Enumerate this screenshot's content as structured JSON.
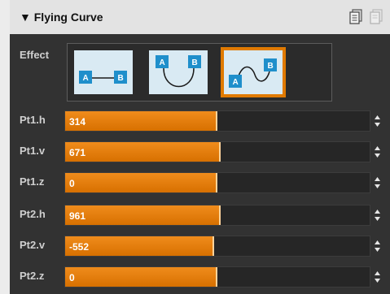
{
  "panel": {
    "title": "Flying Curve",
    "collapse_glyph": "▼",
    "header_icons": [
      "copy-icon",
      "paste-icon"
    ]
  },
  "effect": {
    "label": "Effect",
    "options": [
      {
        "name": "straight-line",
        "point_a": "A",
        "point_b": "B"
      },
      {
        "name": "u-curve",
        "point_a": "A",
        "point_b": "B"
      },
      {
        "name": "s-curve",
        "point_a": "A",
        "point_b": "B"
      }
    ],
    "selected_index": 2
  },
  "sliders": [
    {
      "label": "Pt1.h",
      "value": "314",
      "fill_fraction": 0.5
    },
    {
      "label": "Pt1.v",
      "value": "671",
      "fill_fraction": 0.51
    },
    {
      "label": "Pt1.z",
      "value": "0",
      "fill_fraction": 0.5
    },
    {
      "label": "Pt2.h",
      "value": "961",
      "fill_fraction": 0.51
    },
    {
      "label": "Pt2.v",
      "value": "-552",
      "fill_fraction": 0.49
    },
    {
      "label": "Pt2.z",
      "value": "0",
      "fill_fraction": 0.5
    }
  ],
  "colors": {
    "accent": "#e07a00",
    "panel_bg": "#323232",
    "header_bg": "#e3e3e3",
    "thumb_bg": "#d9eaf3",
    "point_marker": "#1f8fcb"
  }
}
